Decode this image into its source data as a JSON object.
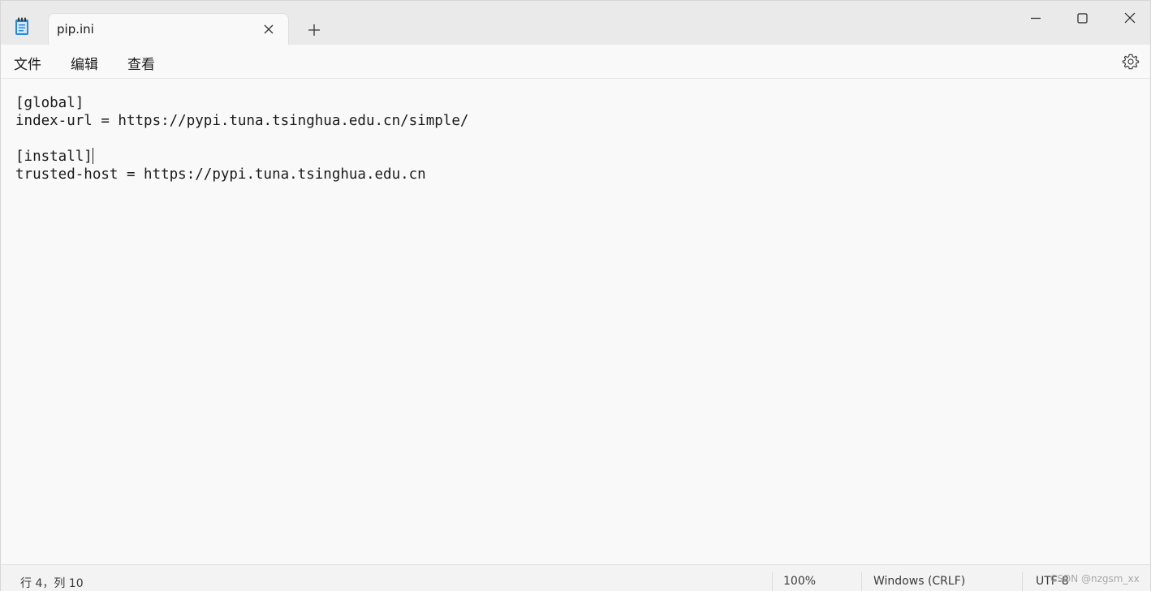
{
  "tab": {
    "title": "pip.ini"
  },
  "menu": {
    "file": "文件",
    "edit": "编辑",
    "view": "查看"
  },
  "editor": {
    "lines": [
      "[global]",
      "index-url = https://pypi.tuna.tsinghua.edu.cn/simple/",
      "",
      "[install]",
      "trusted-host = https://pypi.tuna.tsinghua.edu.cn"
    ]
  },
  "status": {
    "position": "行 4，列 10",
    "zoom": "100%",
    "line_ending": "Windows (CRLF)",
    "encoding": "UTF-8"
  },
  "watermark": "CSDN @nzgsm_xx",
  "icons": {
    "app": "notepad-icon",
    "tab_close": "close-icon",
    "new_tab": "plus-icon",
    "minimize": "minimize-icon",
    "maximize": "maximize-icon",
    "close": "close-icon",
    "settings": "gear-icon"
  },
  "colors": {
    "titlebar_bg": "#eaeaea",
    "editor_bg": "#f9f9f9",
    "app_icon_blue": "#2b88d8"
  }
}
